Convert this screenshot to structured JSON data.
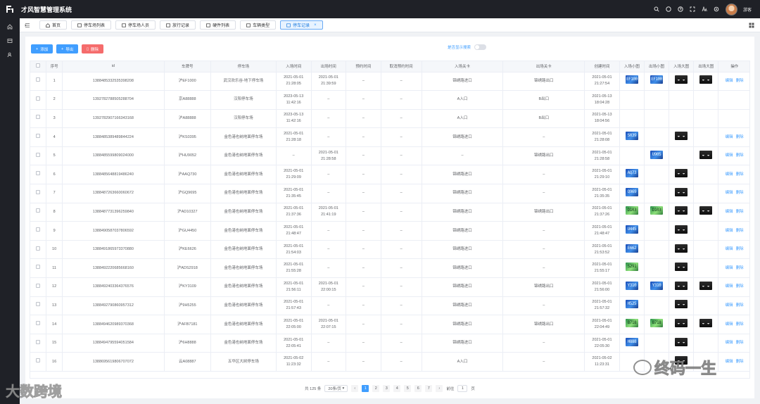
{
  "app": {
    "title": "才风智慧管理系统",
    "user": "游客"
  },
  "tags": [
    {
      "label": "首页",
      "active": false
    },
    {
      "label": "停车场列表",
      "active": false
    },
    {
      "label": "停车场人员",
      "active": false
    },
    {
      "label": "放行记录",
      "active": false
    },
    {
      "label": "硬件列表",
      "active": false
    },
    {
      "label": "车辆类型",
      "active": false
    },
    {
      "label": "停车记录",
      "active": true
    }
  ],
  "toolbar": {
    "add_label": "添加",
    "export_label": "导出",
    "delete_label": "删除",
    "search_toggle_label": "是否显示搜索"
  },
  "table": {
    "headers": [
      "",
      "序号",
      "id",
      "车牌号",
      "停车场",
      "入场时间",
      "出场时间",
      "预约时间",
      "取消预约时间",
      "入场关卡",
      "出场关卡",
      "创建时间",
      "入场小图",
      "出场小图",
      "入场大图",
      "出场大图",
      "操作"
    ],
    "rows": [
      {
        "no": "1",
        "id": "1388485332535398208",
        "plate": "沪EF1000",
        "lot": "武汉欢乐谷-地下停车场",
        "in": "2021-05-01 21:28:05",
        "out": "2021-05-01 21:39:59",
        "rsv": "–",
        "cancel": "–",
        "gate_in": "锦绣路进口",
        "gate_out": "锦绣路出口",
        "created": "2021-05-01 21:27:54",
        "in_s": "EF100",
        "out_s": "EF100",
        "in_s_color": "blue",
        "out_s_color": "blue",
        "in_b": true,
        "out_b": true
      },
      {
        "no": "2",
        "id": "1392782788505288704",
        "plate": "京A88888",
        "lot": "汉阳停车场",
        "in": "2023-05-13 11:42:16",
        "out": "–",
        "rsv": "–",
        "cancel": "–",
        "gate_in": "A入口",
        "gate_out": "B出口",
        "created": "2021-05-13 18:04:28",
        "in_s": "",
        "out_s": "",
        "in_s_color": "",
        "out_s_color": "",
        "in_b": false,
        "out_b": false
      },
      {
        "no": "3",
        "id": "1392782907166343168",
        "plate": "沪A88888",
        "lot": "汉阳停车场",
        "in": "2023-05-13 11:42:16",
        "out": "–",
        "rsv": "–",
        "cancel": "–",
        "gate_in": "A入口",
        "gate_out": "B出口",
        "created": "2021-05-13 18:04:56",
        "in_s": "",
        "out_s": "",
        "in_s_color": "",
        "out_s_color": "",
        "in_b": false,
        "out_b": false
      },
      {
        "no": "4",
        "id": "1388485389489844224",
        "plate": "沪KS0395",
        "lot": "金色港也纳地面停车场",
        "in": "2021-05-01 21:28:18",
        "out": "–",
        "rsv": "–",
        "cancel": "–",
        "gate_in": "锦绣路进口",
        "gate_out": "–",
        "created": "2021-05-01 21:28:08",
        "in_s": "S039",
        "out_s": "",
        "in_s_color": "blue",
        "out_s_color": "",
        "in_b": true,
        "out_b": false
      },
      {
        "no": "5",
        "id": "1388485599809024000",
        "plate": "沪HU9052",
        "lot": "金色港也纳地面停车场",
        "in": "–",
        "out": "2021-05-01 21:28:58",
        "rsv": "–",
        "cancel": "–",
        "gate_in": "–",
        "gate_out": "锦绣路出口",
        "created": "2021-05-01 21:28:58",
        "in_s": "",
        "out_s": "U905",
        "in_s_color": "",
        "out_s_color": "blue",
        "in_b": false,
        "out_b": true
      },
      {
        "no": "6",
        "id": "1388485648819486240",
        "plate": "沪AAQ730",
        "lot": "金色港也纳地面停车场",
        "in": "2021-05-01 21:29:09",
        "out": "–",
        "rsv": "–",
        "cancel": "–",
        "gate_in": "锦绣路进口",
        "gate_out": "–",
        "created": "2021-05-01 21:29:10",
        "in_s": "AQ73",
        "out_s": "",
        "in_s_color": "blue",
        "out_s_color": "",
        "in_b": true,
        "out_b": false
      },
      {
        "no": "7",
        "id": "1388487263660060672",
        "plate": "沪GQ9695",
        "lot": "金色港也纳地面停车场",
        "in": "2021-05-01 21:35:45",
        "out": "–",
        "rsv": "–",
        "cancel": "–",
        "gate_in": "锦绣路进口",
        "gate_out": "–",
        "created": "2021-05-01 21:35:35",
        "in_s": "Q969",
        "out_s": "",
        "in_s_color": "blue",
        "out_s_color": "",
        "in_b": true,
        "out_b": false
      },
      {
        "no": "8",
        "id": "1388487731396259840",
        "plate": "沪AD10327",
        "lot": "金色港也纳地面停车场",
        "in": "2021-05-01 21:37:36",
        "out": "2021-05-01 21:41:19",
        "rsv": "–",
        "cancel": "–",
        "gate_in": "锦绣路进口",
        "gate_out": "锦绣路出口",
        "created": "2021-05-01 21:37:26",
        "in_s": "D103",
        "out_s": "D103",
        "in_s_color": "green",
        "out_s_color": "green",
        "in_b": true,
        "out_b": true
      },
      {
        "no": "9",
        "id": "1388490587037806592",
        "plate": "沪GU4450",
        "lot": "金色港也纳地面停车场",
        "in": "2021-05-01 21:48:47",
        "out": "–",
        "rsv": "–",
        "cancel": "–",
        "gate_in": "锦绣路进口",
        "gate_out": "–",
        "created": "2021-05-01 21:48:47",
        "in_s": "U445",
        "out_s": "",
        "in_s_color": "blue",
        "out_s_color": "",
        "in_b": true,
        "out_b": false
      },
      {
        "no": "10",
        "id": "1388491865973370880",
        "plate": "沪KE6626",
        "lot": "金色港也纳地面停车场",
        "in": "2021-05-01 21:54:03",
        "out": "–",
        "rsv": "–",
        "cancel": "–",
        "gate_in": "锦绣路进口",
        "gate_out": "–",
        "created": "2021-05-01 21:53:52",
        "in_s": "E662",
        "out_s": "",
        "in_s_color": "blue",
        "out_s_color": "",
        "in_b": true,
        "out_b": false
      },
      {
        "no": "11",
        "id": "1388492220685668160",
        "plate": "沪ADS2918",
        "lot": "金色港也纳地面停车场",
        "in": "2021-05-01 21:55:28",
        "out": "–",
        "rsv": "–",
        "cancel": "–",
        "gate_in": "锦绣路进口",
        "gate_out": "–",
        "created": "2021-05-01 21:55:17",
        "in_s": "S291",
        "out_s": "",
        "in_s_color": "green",
        "out_s_color": "",
        "in_b": true,
        "out_b": false
      },
      {
        "no": "12",
        "id": "1388492403364376576",
        "plate": "沪KY3109",
        "lot": "金色港也纳地面停车场",
        "in": "2021-05-01 21:56:11",
        "out": "2021-05-01 22:00:15",
        "rsv": "–",
        "cancel": "–",
        "gate_in": "锦绣路进口",
        "gate_out": "锦绣路出口",
        "created": "2021-05-01 21:56:00",
        "in_s": "Y310",
        "out_s": "Y310",
        "in_s_color": "blue",
        "out_s_color": "blue",
        "in_b": true,
        "out_b": true
      },
      {
        "no": "13",
        "id": "1388492790860957312",
        "plate": "沪9H5255",
        "lot": "金色港也纳地面停车场",
        "in": "2021-05-01 21:57:43",
        "out": "–",
        "rsv": "–",
        "cancel": "–",
        "gate_in": "锦绣路进口",
        "gate_out": "–",
        "created": "2021-05-01 21:57:32",
        "in_s": "H525",
        "out_s": "",
        "in_s_color": "blue",
        "out_s_color": "",
        "in_b": true,
        "out_b": false
      },
      {
        "no": "14",
        "id": "1388494620989370368",
        "plate": "沪AFB7181",
        "lot": "金色港也纳地面停车场",
        "in": "2021-05-01 22:05:00",
        "out": "2021-05-01 22:07:15",
        "rsv": "–",
        "cancel": "–",
        "gate_in": "锦绣路进口",
        "gate_out": "锦绣路出口",
        "created": "2021-05-01 22:04:49",
        "in_s": "B718",
        "out_s": "B718",
        "in_s_color": "green",
        "out_s_color": "green",
        "in_b": true,
        "out_b": true
      },
      {
        "no": "15",
        "id": "1388494795594051584",
        "plate": "沪6H8888",
        "lot": "金色港也纳地面停车场",
        "in": "2021-05-01 22:05:41",
        "out": "–",
        "rsv": "–",
        "cancel": "–",
        "gate_in": "锦绣路进口",
        "gate_out": "–",
        "created": "2021-05-01 22:05:30",
        "in_s": "H888",
        "out_s": "",
        "in_s_color": "blue",
        "out_s_color": "",
        "in_b": true,
        "out_b": false
      },
      {
        "no": "16",
        "id": "1388695619806707072",
        "plate": "云A08887",
        "lot": "五华区大树停车场",
        "in": "2021-05-02 11:23:32",
        "out": "–",
        "rsv": "–",
        "cancel": "–",
        "gate_in": "A入口",
        "gate_out": "–",
        "created": "2021-05-02 11:23:31",
        "in_s": "",
        "out_s": "",
        "in_s_color": "",
        "out_s_color": "",
        "in_b": true,
        "out_b": false
      }
    ],
    "op_edit": "编辑",
    "op_delete": "删除"
  },
  "pagination": {
    "total_text": "共 125 条",
    "page_size": "20条/页",
    "pages": [
      "1",
      "2",
      "3",
      "4",
      "5",
      "6",
      "7"
    ],
    "current": "1",
    "jump_label": "前往",
    "jump_value": "1",
    "page_suffix": "页"
  },
  "watermarks": {
    "left": "大数跨境",
    "right": "终码一生"
  },
  "colors": {
    "primary": "#409eff",
    "danger": "#f56c6c",
    "dark": "#1f2127"
  }
}
